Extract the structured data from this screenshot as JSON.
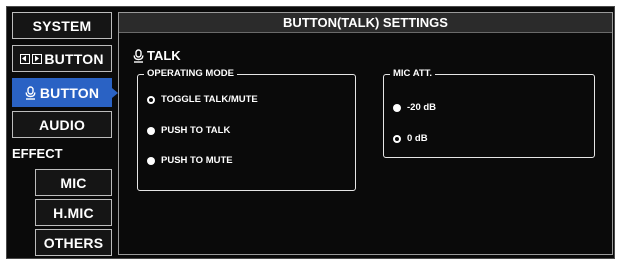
{
  "sidebar": {
    "system": "SYSTEM",
    "arrow_button": "BUTTON",
    "talk_button": "BUTTON",
    "audio": "AUDIO",
    "effect_label": "EFFECT",
    "mic": "MIC",
    "hmic": "H.MIC",
    "others": "OTHERS"
  },
  "header": {
    "title": "BUTTON(TALK) SETTINGS"
  },
  "talk": {
    "title": "TALK"
  },
  "operating_mode": {
    "label": "OPERATING MODE",
    "options": [
      {
        "label": "TOGGLE TALK/MUTE",
        "selected": true
      },
      {
        "label": "PUSH TO TALK",
        "selected": false
      },
      {
        "label": "PUSH TO MUTE",
        "selected": false
      }
    ]
  },
  "mic_att": {
    "label": "MIC ATT.",
    "options": [
      {
        "label": "-20 dB",
        "selected": false
      },
      {
        "label": "0 dB",
        "selected": true
      }
    ]
  },
  "colors": {
    "active_blue": "#2a62c4",
    "background": "#0a0a0a",
    "header_bg": "#2b2b2b"
  },
  "icons": {
    "mic": "mic-icon",
    "arrows": "left-right-arrow-icon"
  }
}
